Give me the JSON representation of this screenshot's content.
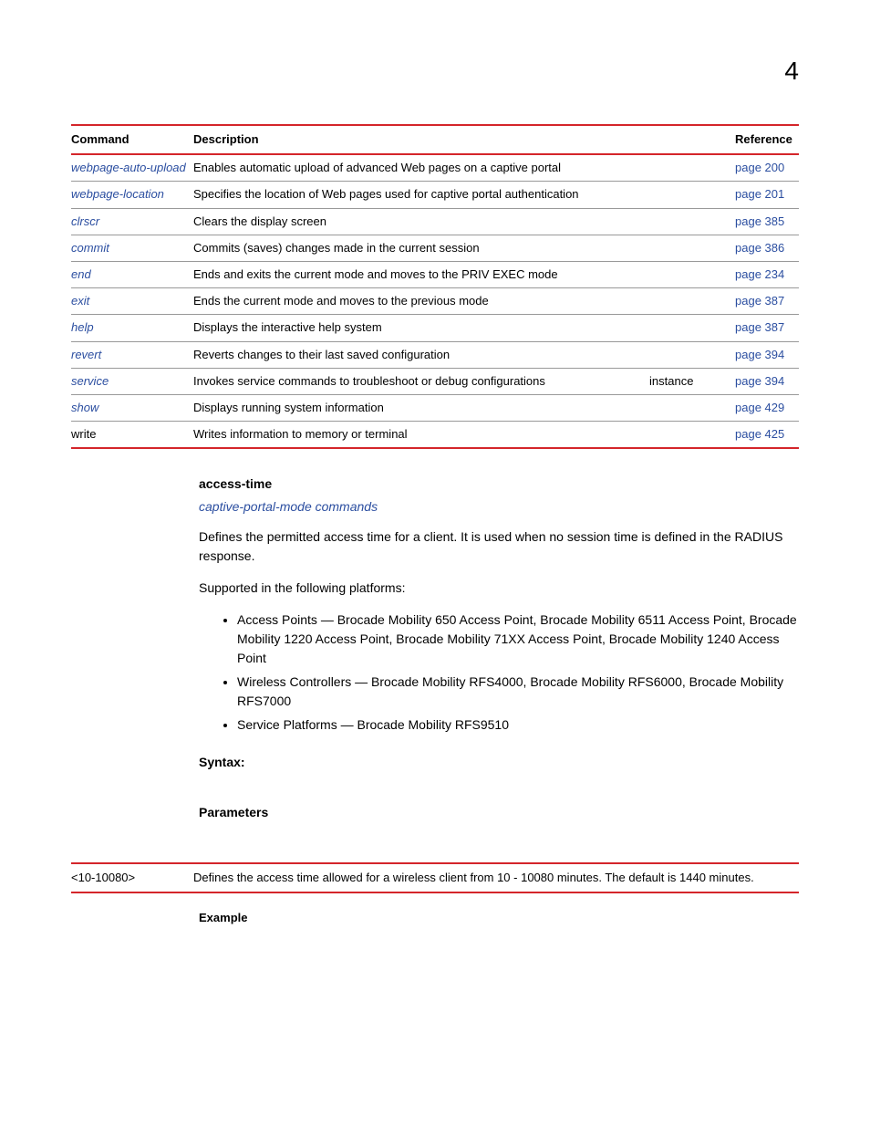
{
  "chapter_number": "4",
  "cmd_table": {
    "headers": {
      "command": "Command",
      "description": "Description",
      "reference": "Reference"
    },
    "rows": [
      {
        "cmd": "webpage-auto-upload",
        "desc": "Enables automatic upload of advanced Web pages on a captive portal",
        "ref": "page 200",
        "cmd_link": true,
        "wrap": true
      },
      {
        "cmd": "webpage-location",
        "desc": "Specifies the location of Web pages used for captive portal authentication",
        "ref": "page 201",
        "cmd_link": true
      },
      {
        "cmd": "clrscr",
        "desc": "Clears the display screen",
        "ref": "page 385",
        "cmd_link": true
      },
      {
        "cmd": "commit",
        "desc": "Commits (saves) changes made in the current session",
        "ref": "page 386",
        "cmd_link": true
      },
      {
        "cmd": "end",
        "desc": "Ends and exits the current mode and moves to the PRIV EXEC mode",
        "ref": "page 234",
        "cmd_link": true
      },
      {
        "cmd": "exit",
        "desc": "Ends the current mode and moves to the previous mode",
        "ref": "page 387",
        "cmd_link": true
      },
      {
        "cmd": "help",
        "desc": "Displays the interactive help system",
        "ref": "page 387",
        "cmd_link": true
      },
      {
        "cmd": "revert",
        "desc": "Reverts changes to their last saved configuration",
        "ref": "page 394",
        "cmd_link": true
      },
      {
        "cmd": "service",
        "desc_left": "Invokes service commands to troubleshoot or debug configurations",
        "desc_right": "instance",
        "ref": "page 394",
        "cmd_link": true,
        "twocol": true
      },
      {
        "cmd": "show",
        "desc": "Displays running system information",
        "ref": "page 429",
        "cmd_link": true
      },
      {
        "cmd": "write",
        "desc": "Writes information to memory or terminal",
        "ref": "page 425",
        "cmd_link": false
      }
    ]
  },
  "section": {
    "heading": "access-time",
    "crossref": "captive-portal-mode commands",
    "para1": "Defines the permitted access time for a client. It is used when no session time is defined in the RADIUS response.",
    "platforms_intro": "Supported in the following platforms:",
    "platforms": [
      "Access Points — Brocade Mobility 650 Access Point, Brocade Mobility 6511 Access Point, Brocade Mobility 1220 Access Point, Brocade Mobility 71XX Access Point, Brocade Mobility 1240 Access Point",
      "Wireless Controllers — Brocade Mobility RFS4000, Brocade Mobility RFS6000, Brocade Mobility RFS7000",
      "Service Platforms — Brocade Mobility RFS9510"
    ],
    "syntax_label": "Syntax:",
    "parameters_label": "Parameters",
    "param_row": {
      "name": "<10-10080>",
      "desc": "Defines the access time allowed for a wireless client from 10 - 10080 minutes. The default is 1440 minutes."
    },
    "example_label": "Example"
  }
}
